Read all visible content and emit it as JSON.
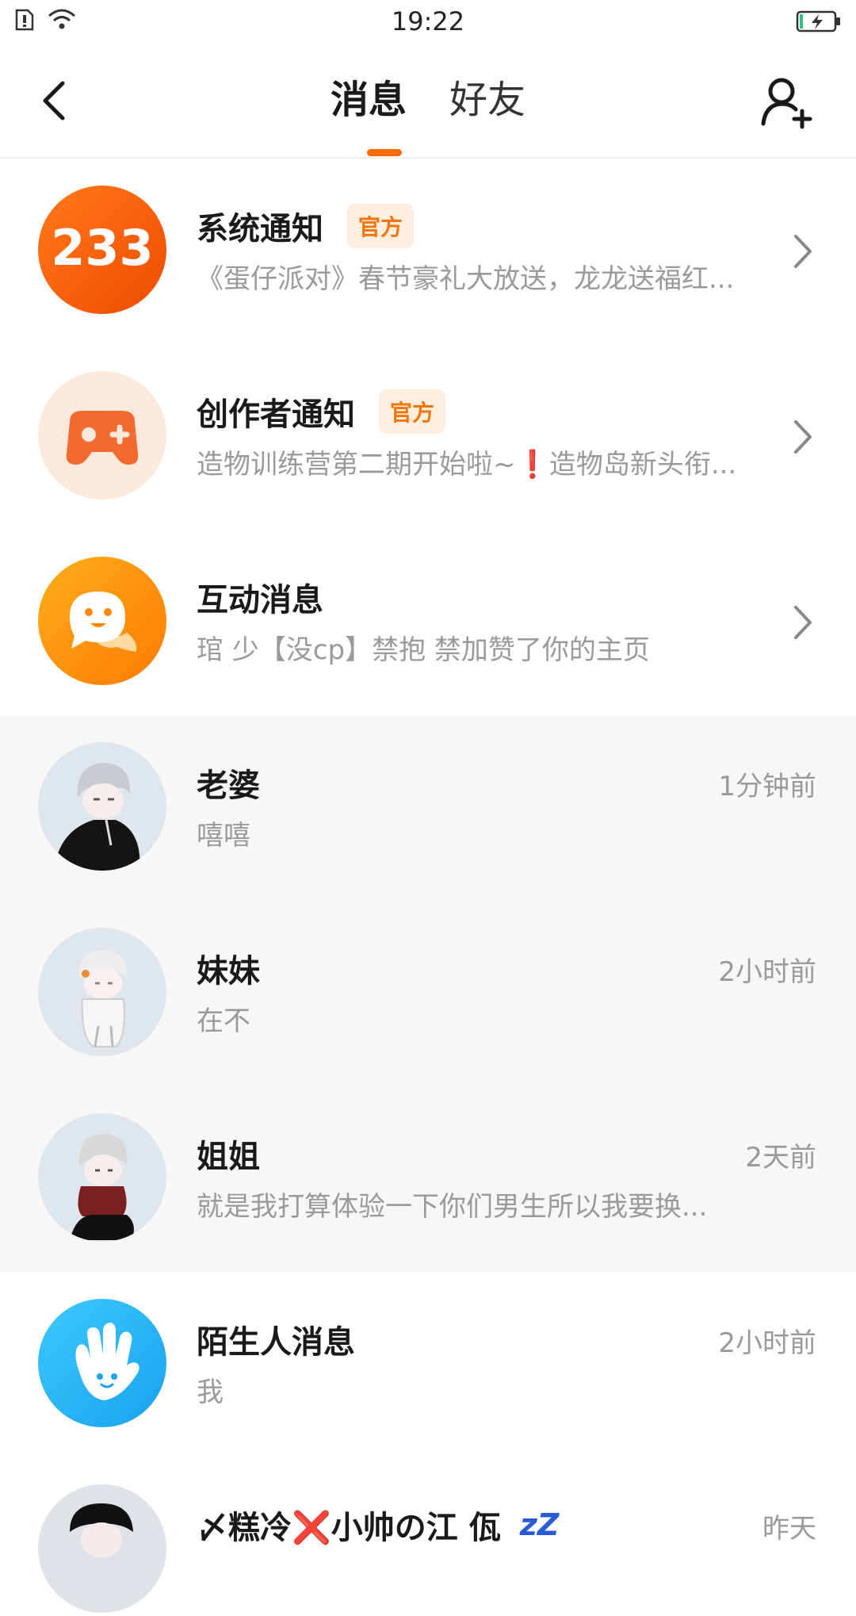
{
  "status_bar": {
    "time": "19:22"
  },
  "header": {
    "tabs": [
      {
        "label": "消息",
        "active": true
      },
      {
        "label": "好友",
        "active": false
      }
    ],
    "accent_color": "#ff6a00"
  },
  "list": {
    "system": {
      "avatar_text": "233",
      "title": "系统通知",
      "badge": "官方",
      "preview": "《蛋仔派对》春节豪礼大放送，龙龙送福红..."
    },
    "creator": {
      "title": "创作者通知",
      "badge": "官方",
      "preview": "造物训练营第二期开始啦~❗造物岛新头衔..."
    },
    "interaction": {
      "title": "互动消息",
      "preview": "琯 少【没cp】禁抱 禁加赞了你的主页"
    },
    "chats": [
      {
        "name": "老婆",
        "preview": "嘻嘻",
        "time": "1分钟前"
      },
      {
        "name": "妹妹",
        "preview": "在不",
        "time": "2小时前"
      },
      {
        "name": "姐姐",
        "preview": "就是我打算体验一下你们男生所以我要换...",
        "time": "2天前"
      }
    ],
    "stranger": {
      "title": "陌生人消息",
      "preview": "我",
      "time": "2小时前"
    },
    "partial": {
      "name": "〆糕冷❌小帅の江 佤",
      "sleep_mark": "zZ",
      "time": "昨天"
    }
  }
}
